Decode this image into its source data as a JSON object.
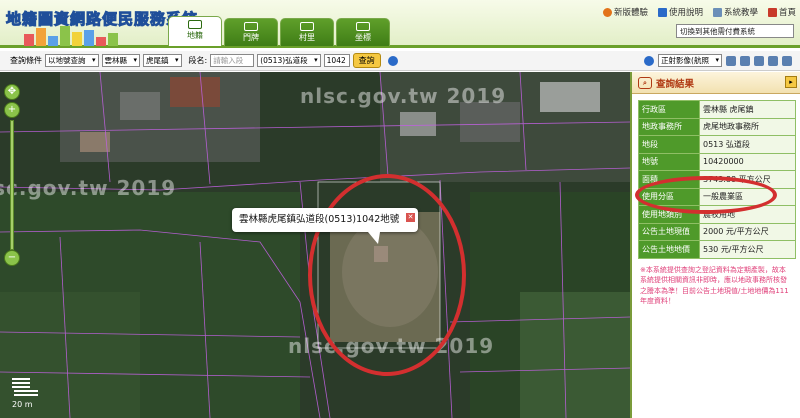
{
  "header": {
    "title": "地籍圖資網路便民服務系統",
    "tabs": [
      {
        "label": "地籍",
        "icon": "map-icon",
        "active": true
      },
      {
        "label": "門牌",
        "icon": "doorplate-icon",
        "active": false
      },
      {
        "label": "村里",
        "icon": "village-icon",
        "active": false
      },
      {
        "label": "坐標",
        "icon": "coordinate-icon",
        "active": false
      }
    ],
    "links": [
      {
        "label": "新版體驗",
        "icon": "new-version-icon"
      },
      {
        "label": "使用說明",
        "icon": "help-book-icon"
      },
      {
        "label": "系統教學",
        "icon": "tutorial-icon"
      },
      {
        "label": "首頁",
        "icon": "home-icon"
      }
    ],
    "switch_select": "切換到其他需付費系統"
  },
  "query": {
    "condition_label": "查詢條件",
    "mode": "以地號查詢",
    "county": "雲林縣",
    "town": "虎尾鎮",
    "section_label": "段名:",
    "section_input_placeholder": "請輸入段",
    "section": "(0513)弘道段",
    "parcel_no": "1042",
    "search_button": "查詢",
    "imagery": "正射影像(航照"
  },
  "map": {
    "watermark": "nlsc.gov.tw 2019",
    "popup_text": "雲林縣虎尾鎮弘道段(0513)1042地號",
    "scale_label": "20 m"
  },
  "panel": {
    "title": "查詢結果",
    "rows": [
      {
        "key": "行政區",
        "value": "雲林縣 虎尾鎮"
      },
      {
        "key": "地政事務所",
        "value": "虎尾地政事務所"
      },
      {
        "key": "地段",
        "value": "0513 弘道段"
      },
      {
        "key": "地號",
        "value": "10420000"
      },
      {
        "key": "面積",
        "value": "3743.88 平方公尺"
      },
      {
        "key": "使用分區",
        "value": "一般農業區"
      },
      {
        "key": "使用地類別",
        "value": "農牧用地"
      },
      {
        "key": "公告土地現值",
        "value": "2000 元/平方公尺"
      },
      {
        "key": "公告土地地價",
        "value": "530 元/平方公尺"
      }
    ],
    "notice": "※本系統提供查詢之登記資料為定期產製，故本系統提供相關資訊非即時，應以地政事務所核發之謄本為準！目前公告土地現值/土地地價為111年度資料！"
  },
  "colors": {
    "accent_green": "#4f9a2a",
    "highlight_red": "#d32f2f",
    "search_button": "#f5c842"
  }
}
